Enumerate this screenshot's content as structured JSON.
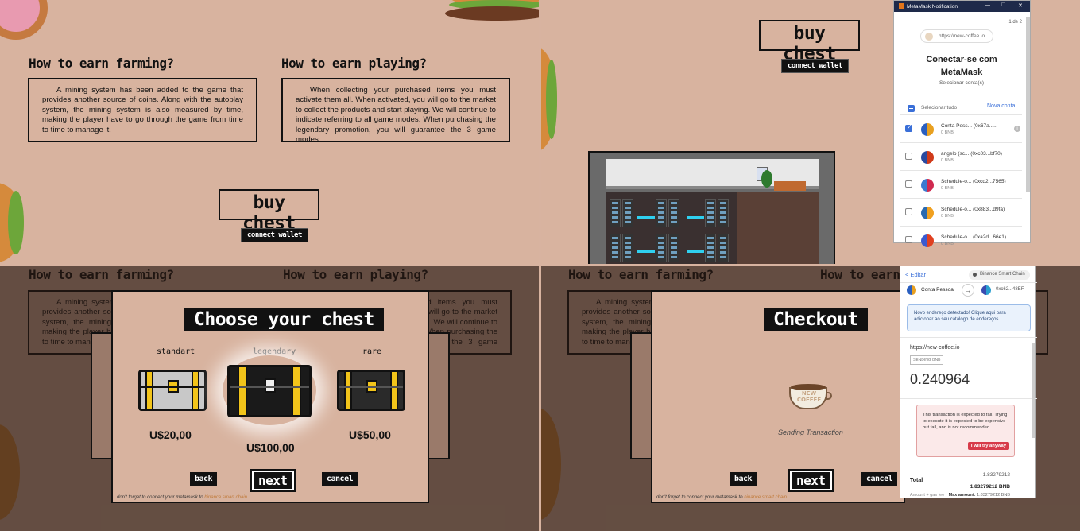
{
  "page": {
    "farming_heading": "How to earn farming?",
    "playing_heading": "How to earn playing?",
    "farming_text": "A mining system has been added to the game that provides another source of coins. Along with the autoplay system, the mining system is also measured by time, making the player have to go through the game from time to time to manage it.",
    "playing_text": "When collecting your purchased items you must activate them all. When activated, you will go to the market to collect the products and start playing. We will continue to indicate referring to all game modes. When purchasing the legendary promotion, you will guarantee the 3 game modes.",
    "buy_chest": "buy chest",
    "connect_wallet": "connect wallet"
  },
  "metamask": {
    "window_title": "MetaMask Notification",
    "page_counter": "1 de 2",
    "site_url": "https://new-coffee.io",
    "heading": "Conectar-se com MetaMask",
    "subheading": "Selecionar conta(s)",
    "select_all": "Selecionar tudo",
    "new_account": "Nova conta",
    "accounts": [
      {
        "name": "Conta Pess... (0x67a......",
        "balance": "0 BNB",
        "checked": true,
        "color_a": "#e8a020",
        "color_b": "#2a5fc0"
      },
      {
        "name": "angelo (sc... (0xc03...bf70)",
        "balance": "0 BNB",
        "checked": false,
        "color_a": "#d03a1a",
        "color_b": "#2a4aa0"
      },
      {
        "name": "Schedule-o... (0xcd2...7565)",
        "balance": "0 BNB",
        "checked": false,
        "color_a": "#d02a50",
        "color_b": "#3a7ad0"
      },
      {
        "name": "Schedule-o... (0x883...d9fa)",
        "balance": "0 BNB",
        "checked": false,
        "color_a": "#f0a020",
        "color_b": "#2a6ab0"
      },
      {
        "name": "Schedule-o... (0xa2d...66e1)",
        "balance": "0 BNB",
        "checked": false,
        "color_a": "#e04020",
        "color_b": "#3a5ad0"
      }
    ]
  },
  "choose": {
    "title": "Choose your chest",
    "chests": [
      {
        "label": "standart",
        "price": "U$20,00",
        "color": "#c8c8c8"
      },
      {
        "label": "legendary",
        "price": "U$100,00",
        "color": "#1a1a1a"
      },
      {
        "label": "rare",
        "price": "U$50,00",
        "color": "#2a2a2a"
      }
    ],
    "back": "back",
    "next": "next",
    "cancel": "cancel",
    "footnote": "don't forget to connect your metamask to",
    "footnote_link": "binance smart chain"
  },
  "checkout": {
    "title": "Checkout",
    "status": "Sending Transaction",
    "logo_text": "NEW COFFEE",
    "back": "back",
    "next": "next",
    "cancel": "cancel"
  },
  "tx": {
    "edit": "< Editar",
    "network": "Binance Smart Chain",
    "from": "Conta Pessoal",
    "to": "0xc62...48EF",
    "notice": "Novo endereço detectado! Clique aqui para adicionar ao seu catálogo de endereços.",
    "origin": "https://new-coffee.io",
    "tag": "SENDING BNB",
    "amount": "0.240964",
    "warning": "This transaction is expected to fail. Trying to execute it is expected to be expensive but fail, and is not recommended.",
    "try_anyway": "I will try anyway",
    "total_label": "Total",
    "total_value": "1.83279212",
    "total_bnb": "1.83279212 BNB",
    "amount_gas": "Amount + gas fee",
    "max_amount_label": "Max amount:",
    "max_amount": "1.83279212 BNB"
  }
}
